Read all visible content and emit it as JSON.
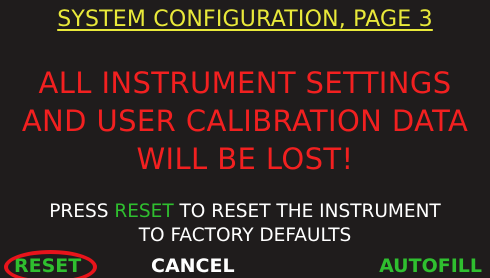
{
  "screen": {
    "title": "SYSTEM CONFIGURATION, PAGE 3",
    "warning_lines": [
      "ALL INSTRUMENT SETTINGS",
      "AND USER CALIBRATION DATA",
      "WILL BE LOST!"
    ],
    "instruction": {
      "line1_before": "PRESS ",
      "line1_highlight": "RESET",
      "line1_after": " TO RESET THE INSTRUMENT",
      "line2": "TO FACTORY DEFAULTS"
    }
  },
  "softkeys": {
    "reset": "RESET",
    "cancel": "CANCEL",
    "autofill": "AUTOFILL"
  },
  "colors": {
    "background": "#1f1c1c",
    "title": "#e9e93a",
    "warning": "#f22020",
    "highlight": "#2fbf2f",
    "annotation_circle": "#e8141b"
  }
}
